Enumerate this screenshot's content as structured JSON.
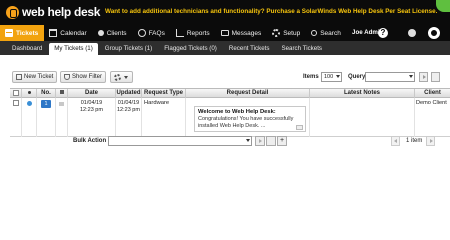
{
  "colors": {
    "banner": "#0b0b0b",
    "active_tab": "#f2a30f",
    "promo_text": "#f6c40c",
    "subnav": "#2e2e2e",
    "status_green": "#5fbf3f",
    "badge_blue": "#2e77c7"
  },
  "brand": {
    "logo_text": "web help desk",
    "logo_icon": "orange-circle-mark"
  },
  "promo": {
    "text": "Want to add additional technicians and functionality? Purchase a SolarWinds Web Help Desk Per Seat License."
  },
  "nav": {
    "items": [
      {
        "label": "Tickets",
        "icon": "ticket-icon"
      },
      {
        "label": "Calendar",
        "icon": "calendar-icon"
      },
      {
        "label": "Clients",
        "icon": "clients-icon"
      },
      {
        "label": "FAQs",
        "icon": "faq-icon"
      },
      {
        "label": "Reports",
        "icon": "reports-icon"
      },
      {
        "label": "Messages",
        "icon": "messages-icon"
      },
      {
        "label": "Setup",
        "icon": "setup-icon"
      },
      {
        "label": "Search",
        "icon": "search-icon"
      }
    ],
    "user": "Joe Admin",
    "help": "?"
  },
  "subtabs": [
    "Dashboard",
    "My Tickets (1)",
    "Group Tickets (1)",
    "Flagged Tickets (0)",
    "Recent Tickets",
    "Search Tickets"
  ],
  "toolbar": {
    "new_ticket": "New Ticket",
    "show_filter": "Show Filter",
    "items_label": "Items",
    "items_value": "100",
    "query_label": "Query"
  },
  "table": {
    "headers": [
      "No.",
      "Date",
      "Updated",
      "Request Type",
      "Request Detail",
      "Latest Notes",
      "Client"
    ],
    "rows": [
      {
        "no": "1",
        "date_line1": "01/04/19",
        "date_line2": "12:23 pm",
        "updated_line1": "01/04/19",
        "updated_line2": "12:23 pm",
        "request_type": "Hardware",
        "detail_title": "Welcome to Web Help Desk:",
        "detail_body": "Congratulations! You have successfully installed Web Help Desk. ...",
        "client": "Demo Client"
      }
    ]
  },
  "footer": {
    "bulk_action_label": "Bulk Action",
    "item_count": "1 item"
  }
}
